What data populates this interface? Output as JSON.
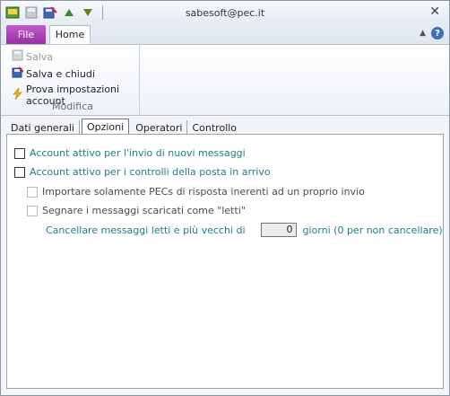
{
  "window": {
    "title": "sabesoft@pec.it"
  },
  "ribbon": {
    "tabs": {
      "file": "File",
      "home": "Home"
    },
    "buttons": {
      "save": "Salva",
      "save_close": "Salva e chiudi",
      "test_settings": "Prova impostazioni account"
    },
    "group_label": "Modifica"
  },
  "content_tabs": [
    "Dati generali",
    "Opzioni",
    "Operatori",
    "Controllo"
  ],
  "options": {
    "send_active": "Account attivo per l'invio di nuovi messaggi",
    "receive_active": "Account attivo per i controlli della posta in arrivo",
    "import_reply_pecs": "Importare solamente PECs di risposta inerenti ad un proprio invio",
    "mark_read": "Segnare i messaggi scaricati come \"letti\"",
    "delete_prefix": "Cancellare messaggi letti e più vecchi di",
    "delete_days": "0",
    "delete_suffix": "giorni (0 per non cancellare)"
  }
}
